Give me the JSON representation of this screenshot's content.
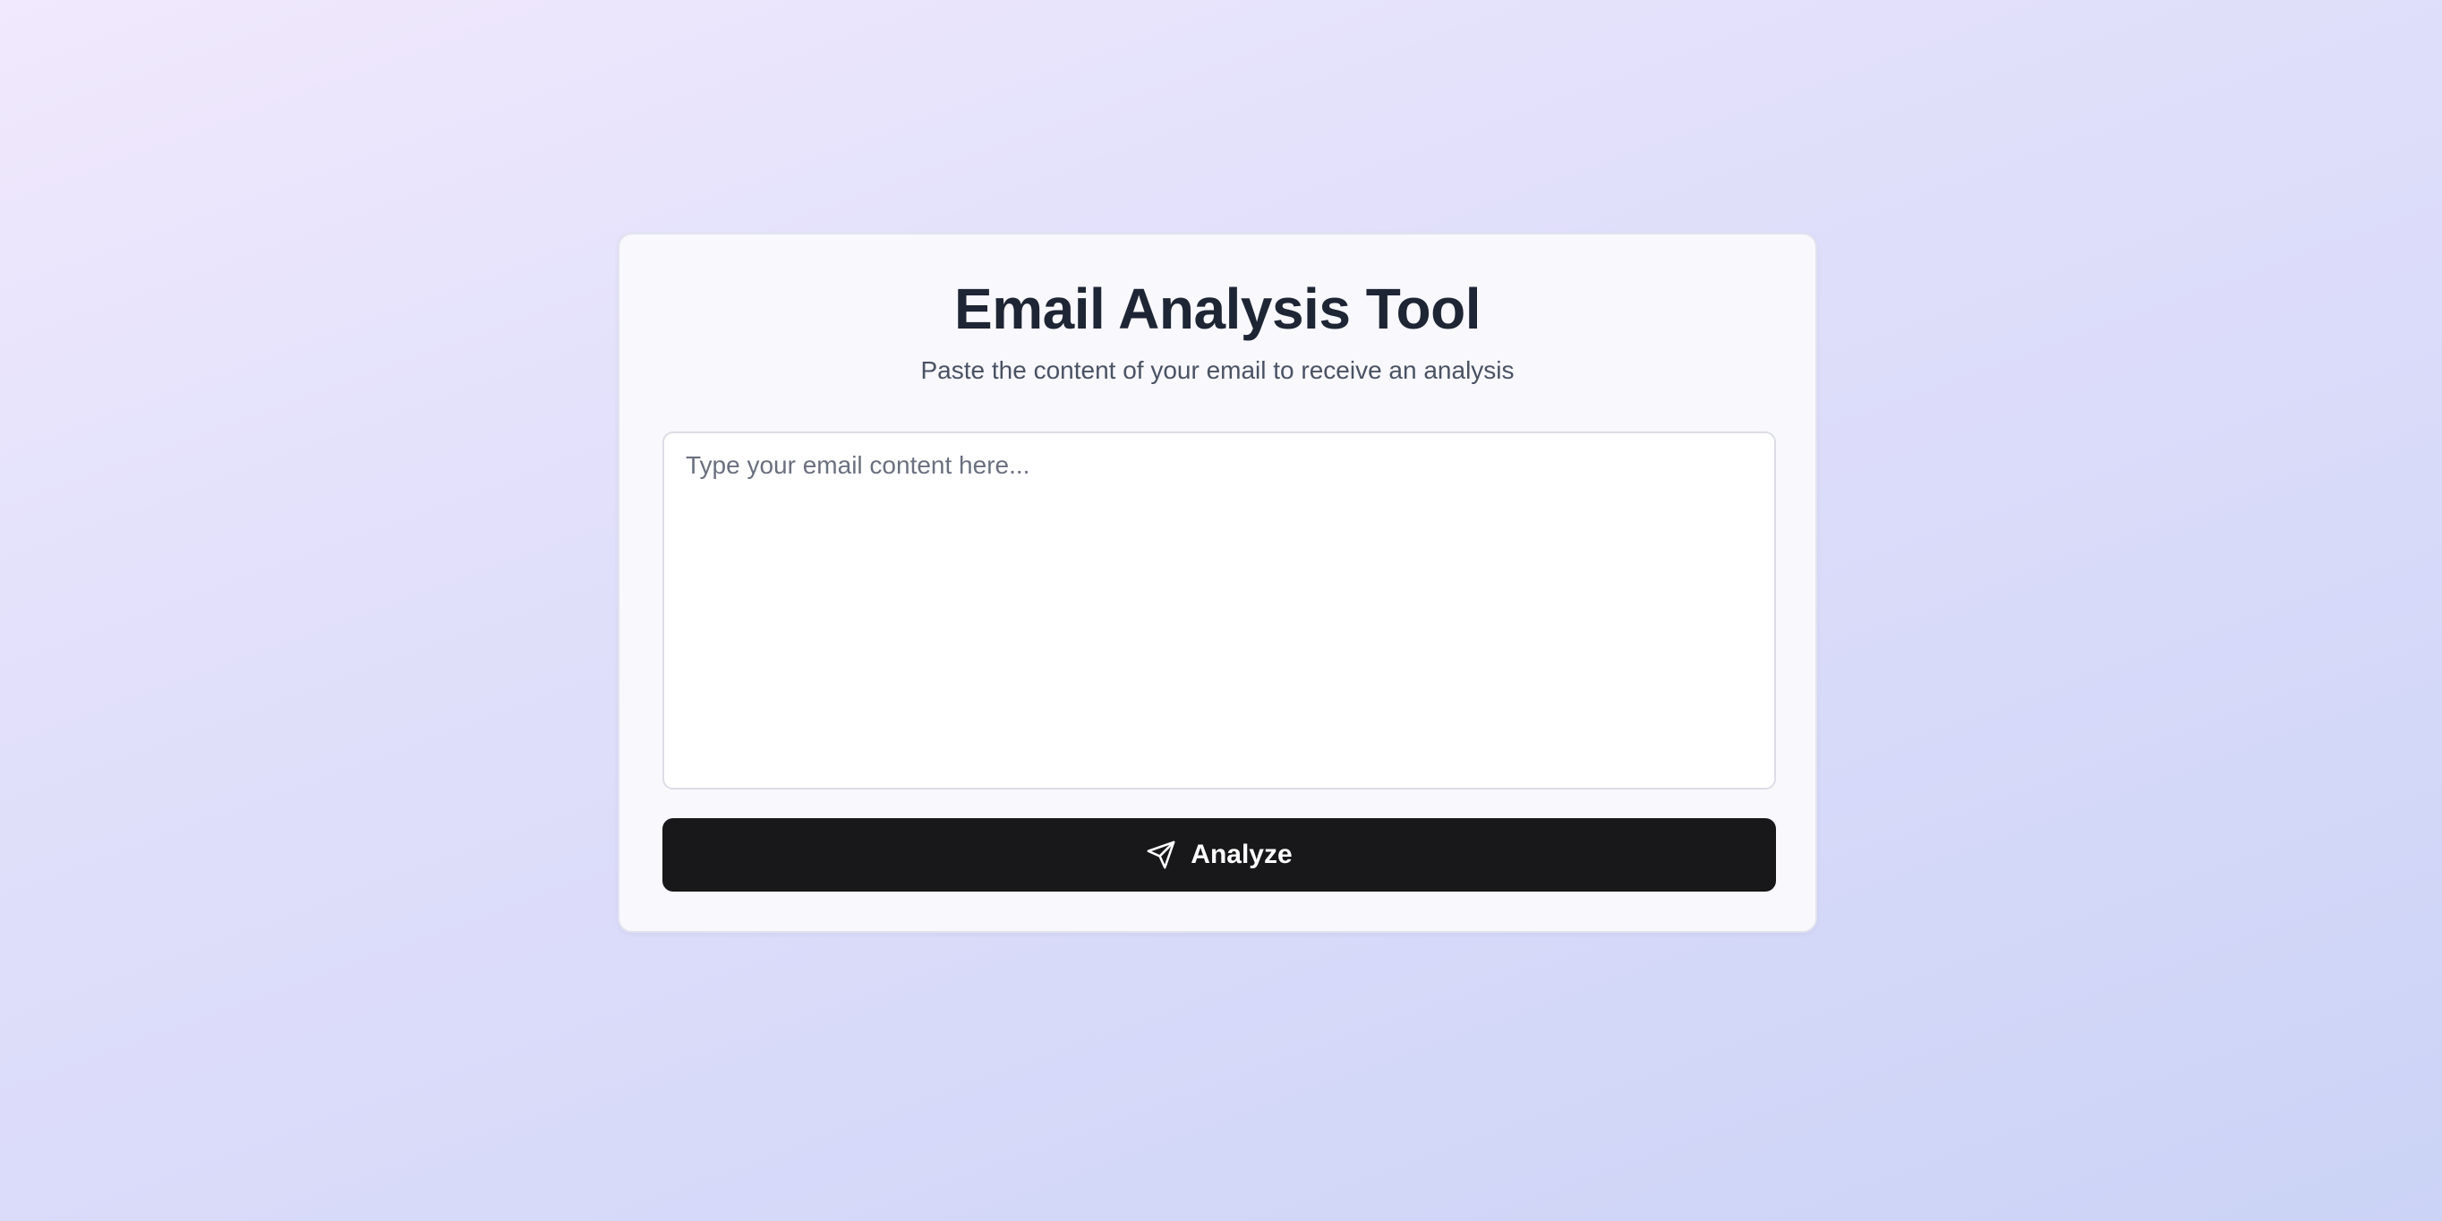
{
  "header": {
    "title": "Email Analysis Tool",
    "subtitle": "Paste the content of your email to receive an analysis"
  },
  "form": {
    "email_placeholder": "Type your email content here...",
    "email_value": "",
    "analyze_label": "Analyze",
    "analyze_icon": "send-icon"
  },
  "colors": {
    "button_background": "#18181b",
    "title_color": "#1e2535",
    "card_background": "#f8f8fd"
  }
}
